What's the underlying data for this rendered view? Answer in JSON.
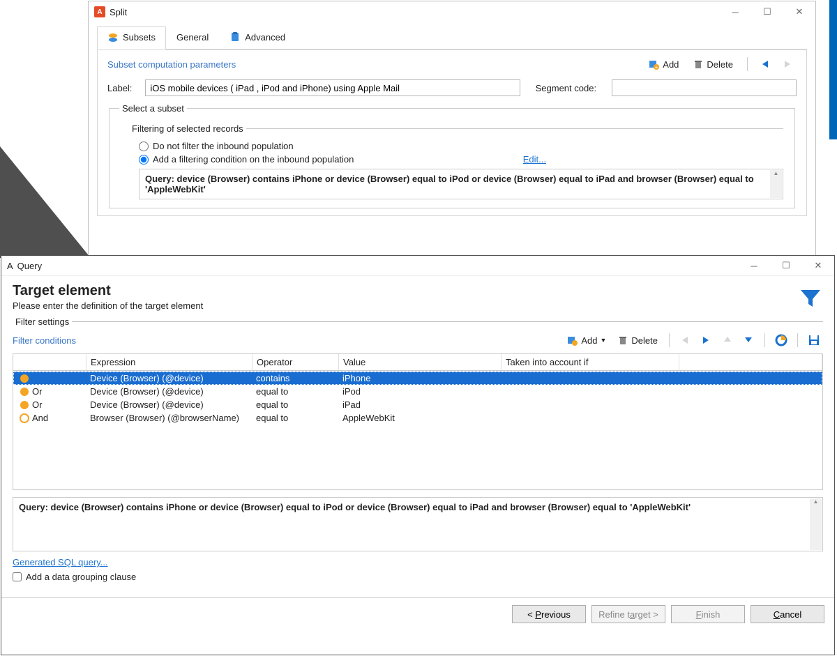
{
  "splitWindow": {
    "title": "Split",
    "tabs": {
      "subsets": "Subsets",
      "general": "General",
      "advanced": "Advanced"
    },
    "panelTitle": "Subset computation parameters",
    "addLabel": "Add",
    "deleteLabel": "Delete",
    "labelLabel": "Label:",
    "labelValue": "iOS mobile devices ( iPad , iPod and iPhone) using Apple Mail",
    "segmentCodeLabel": "Segment code:",
    "segmentCodeValue": "",
    "subsetLegend": "Select a subset",
    "filteringLegend": "Filtering of selected records",
    "radioNoFilter": "Do not filter the inbound population",
    "radioFilter": "Add a filtering condition on the inbound population",
    "editLink": "Edit...",
    "queryText": "Query: device (Browser) contains iPhone or device (Browser) equal to iPod or device (Browser) equal to iPad and browser (Browser) equal to 'AppleWebKit'"
  },
  "queryWindow": {
    "title": "Query",
    "heading": "Target element",
    "subheading": "Please enter the definition of the target element",
    "filterSettingsLegend": "Filter settings",
    "filterConditionsTitle": "Filter conditions",
    "addLabel": "Add",
    "deleteLabel": "Delete",
    "columns": {
      "logic": "",
      "expression": "Expression",
      "operator": "Operator",
      "value": "Value",
      "takenInto": "Taken into account if"
    },
    "rows": [
      {
        "logic": "",
        "expression": "Device (Browser) (@device)",
        "operator": "contains",
        "value": "iPhone",
        "tia": ""
      },
      {
        "logic": "Or",
        "expression": "Device (Browser) (@device)",
        "operator": "equal to",
        "value": "iPod",
        "tia": ""
      },
      {
        "logic": "Or",
        "expression": "Device (Browser) (@device)",
        "operator": "equal to",
        "value": "iPad",
        "tia": ""
      },
      {
        "logic": "And",
        "expression": "Browser (Browser) (@browserName)",
        "operator": "equal to",
        "value": "AppleWebKit",
        "tia": ""
      }
    ],
    "summary": "Query: device (Browser) contains iPhone or device (Browser) equal to iPod or device (Browser) equal to iPad and browser (Browser) equal to 'AppleWebKit'",
    "sqlLink": "Generated SQL query...",
    "groupingCheckboxLabel": "Add a data grouping clause",
    "groupingChecked": false,
    "buttons": {
      "previous": "< Previous",
      "refine": "Refine target >",
      "finish": "Finish",
      "cancel": "Cancel"
    }
  }
}
